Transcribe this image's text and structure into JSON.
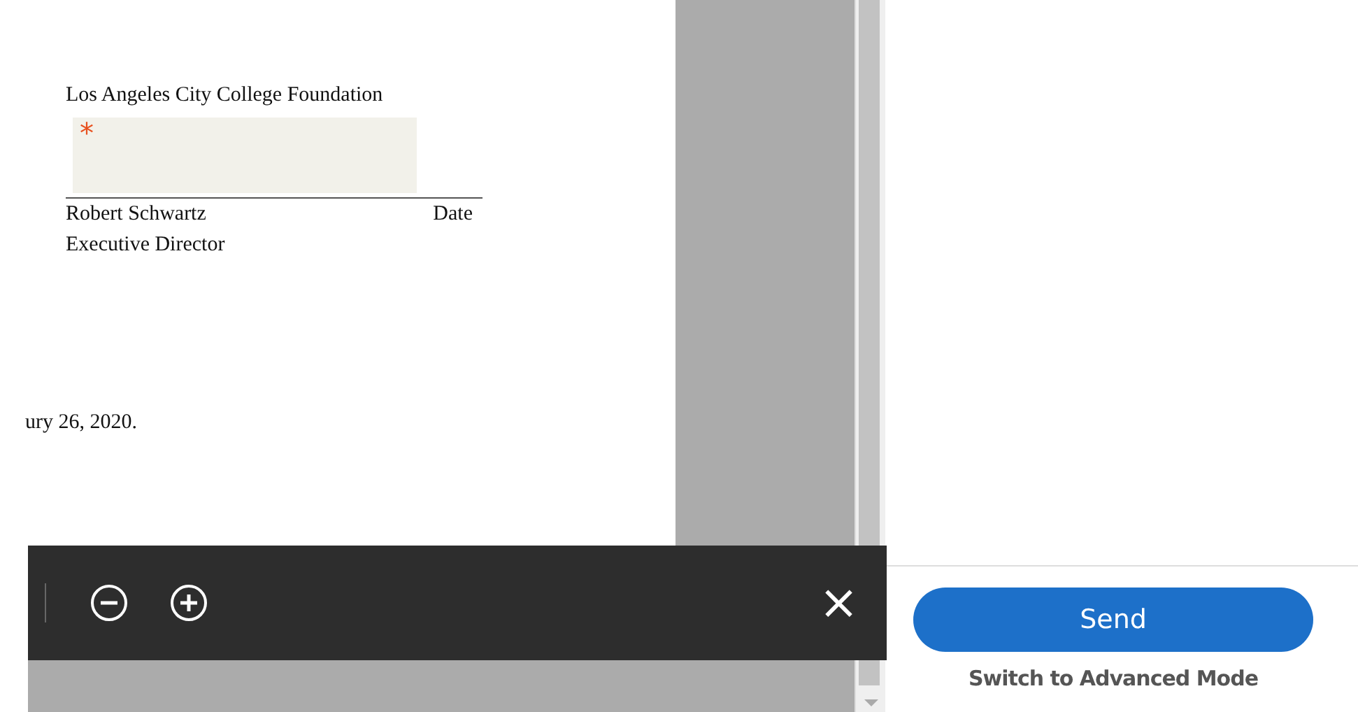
{
  "document": {
    "organization": "Los Angeles City College Foundation",
    "signature_field": {
      "required_mark": "*"
    },
    "signer_name": "Robert Schwartz",
    "date_label": "Date",
    "signer_title": "Executive Director",
    "date_text": "ury 26, 2020."
  },
  "toolbar": {
    "buttons": [
      {
        "kind": "zoom-out"
      },
      {
        "kind": "zoom-in"
      }
    ],
    "close": "×"
  },
  "panel": {
    "send_button": "Send",
    "advanced_link": "Switch to Advanced Mode"
  }
}
